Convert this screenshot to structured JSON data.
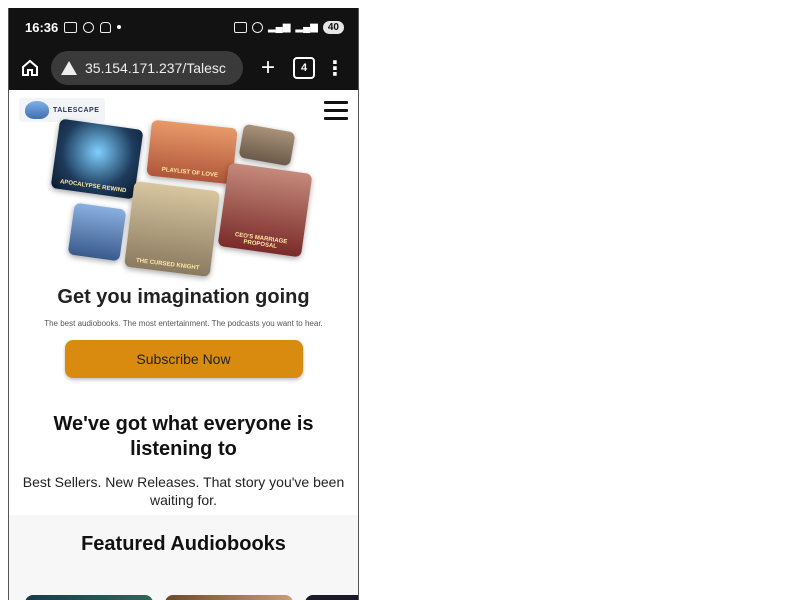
{
  "status_bar": {
    "time": "16:36",
    "battery": "40"
  },
  "browser": {
    "url": "35.154.171.237/Talesc",
    "tab_count": "4"
  },
  "site": {
    "logo_text": "TALESCAPE"
  },
  "collage": [
    {
      "title": "APOCALYPSE REWIND",
      "color": "#1d3b5c"
    },
    {
      "title": "PLAYLIST OF LOVE",
      "color": "#b0563a"
    },
    {
      "title": "",
      "color": "#6b5a4a"
    },
    {
      "title": "",
      "color": "#3a5a8c"
    },
    {
      "title": "THE CURSED KNIGHT",
      "color": "#8a7a60"
    },
    {
      "title": "CEO'S MARRIAGE PROPOSAL",
      "color": "#7a2a2a"
    }
  ],
  "hero": {
    "title": "Get you imagination going",
    "subtitle": "The best audiobooks. The most entertainment. The podcasts you want to hear.",
    "cta": "Subscribe Now"
  },
  "listening": {
    "title": "We've got what everyone is listening to",
    "subtitle": "Best Sellers. New Releases. That story you've been waiting for."
  },
  "featured": {
    "title": "Featured Audiobooks"
  },
  "colors": {
    "accent": "#d98b0f",
    "browser_bg": "#121212"
  }
}
